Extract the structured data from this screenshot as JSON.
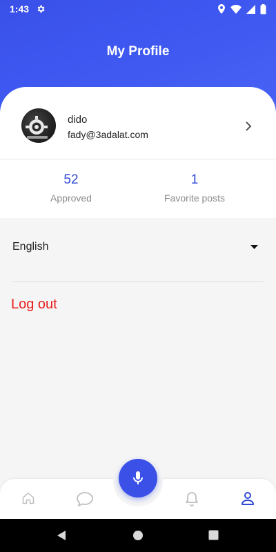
{
  "status_bar": {
    "time": "1:43"
  },
  "header": {
    "title": "My Profile"
  },
  "profile": {
    "name": "dido",
    "email": "fady@3adalat.com",
    "avatar_icon": "avatar-image"
  },
  "stats": [
    {
      "value": "52",
      "label": "Approved"
    },
    {
      "value": "1",
      "label": "Favorite posts"
    }
  ],
  "language": {
    "selected": "English"
  },
  "logout_label": "Log out",
  "bottom_nav": {
    "items": [
      "home-icon",
      "chat-icon",
      "mic-icon",
      "bell-icon",
      "person-icon"
    ],
    "active": "person-icon"
  },
  "colors": {
    "primary": "#3a51e8",
    "stat_value": "#3049d6",
    "logout": "#e81b1b"
  }
}
